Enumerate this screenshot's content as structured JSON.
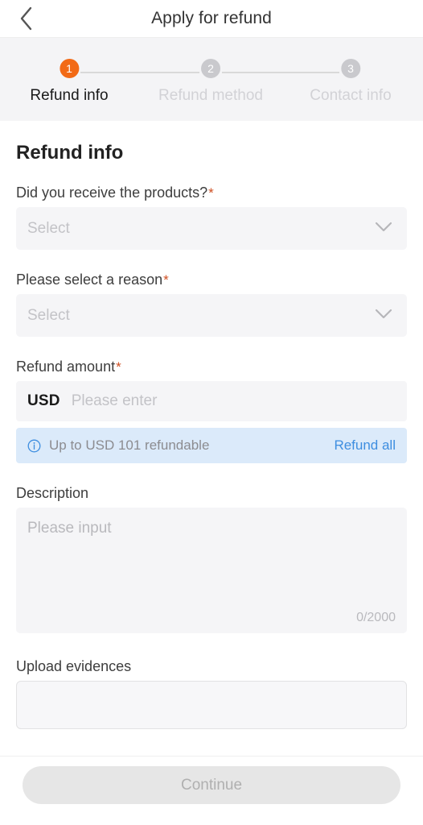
{
  "header": {
    "back_icon": "chevron-left-icon",
    "title": "Apply for refund"
  },
  "stepper": {
    "active_color": "#f26a16",
    "inactive_color": "#c9c9cd",
    "steps": [
      {
        "number": "1",
        "label": "Refund info",
        "state": "active"
      },
      {
        "number": "2",
        "label": "Refund method",
        "state": "inactive"
      },
      {
        "number": "3",
        "label": "Contact info",
        "state": "inactive"
      }
    ]
  },
  "form": {
    "section_title": "Refund info",
    "required_mark": "*",
    "received_products": {
      "label": "Did you receive the products?",
      "required": true,
      "value": "",
      "placeholder": "Select",
      "icon": "chevron-down-icon"
    },
    "reason": {
      "label": "Please select a reason",
      "required": true,
      "value": "",
      "placeholder": "Select",
      "icon": "chevron-down-icon"
    },
    "refund_amount": {
      "label": "Refund amount",
      "required": true,
      "currency": "USD",
      "value": "",
      "placeholder": "Please enter"
    },
    "refund_info_bar": {
      "icon": "info-circle-icon",
      "text": "Up to USD 101 refundable",
      "action_label": "Refund all",
      "action_color": "#3e8ee0",
      "background": "#dbeafa"
    },
    "description": {
      "label": "Description",
      "value": "",
      "placeholder": "Please input",
      "counter": "0/2000"
    },
    "upload": {
      "label": "Upload evidences"
    }
  },
  "footer": {
    "continue_label": "Continue",
    "disabled": true
  }
}
